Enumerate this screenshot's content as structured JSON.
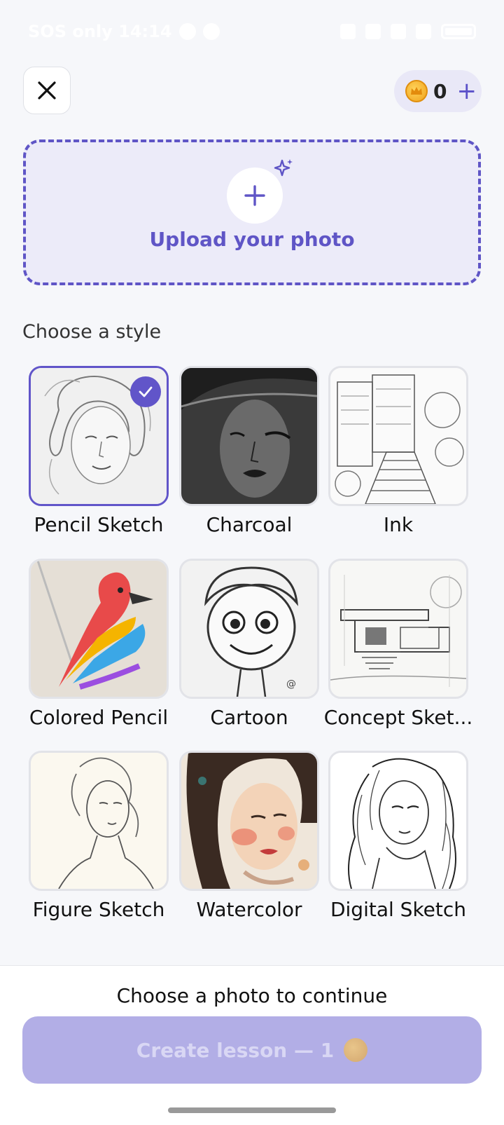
{
  "status_bar": {
    "text": "SOS only 14:14"
  },
  "header": {
    "close_icon": "close-icon",
    "coin_count": "0",
    "coin_plus": "+"
  },
  "upload": {
    "label": "Upload your photo",
    "plus": "+"
  },
  "styles_section": {
    "title": "Choose a style",
    "items": [
      {
        "label": "Pencil Sketch",
        "selected": true
      },
      {
        "label": "Charcoal",
        "selected": false
      },
      {
        "label": "Ink",
        "selected": false
      },
      {
        "label": "Colored Pencil",
        "selected": false
      },
      {
        "label": "Cartoon",
        "selected": false
      },
      {
        "label": "Concept Sket...",
        "selected": false
      },
      {
        "label": "Figure Sketch",
        "selected": false
      },
      {
        "label": "Watercolor",
        "selected": false
      },
      {
        "label": "Digital Sketch",
        "selected": false
      }
    ]
  },
  "footer": {
    "hint": "Choose a photo to continue",
    "create_button": "Create lesson — 1"
  },
  "colors": {
    "accent": "#6155c9",
    "button_disabled": "#b2aee6"
  }
}
